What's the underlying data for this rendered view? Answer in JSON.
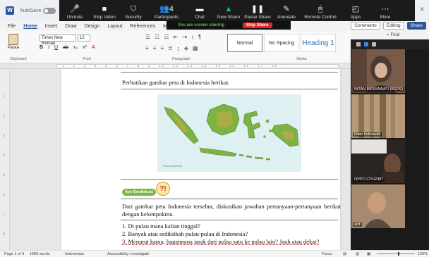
{
  "zoom": {
    "toolbar": [
      {
        "label": "Unmute",
        "icon": "microphone-muted-icon",
        "glyph": "🎤"
      },
      {
        "label": "Stop Video",
        "icon": "video-camera-icon",
        "glyph": "■"
      },
      {
        "label": "Security",
        "icon": "shield-icon",
        "glyph": "⛉"
      },
      {
        "label": "Participants",
        "icon": "participants-icon",
        "glyph": "👥",
        "count": "4"
      },
      {
        "label": "Chat",
        "icon": "chat-bubble-icon",
        "glyph": "▬"
      },
      {
        "label": "New Share",
        "icon": "share-arrow-icon",
        "glyph": "▲"
      },
      {
        "label": "Pause Share",
        "icon": "pause-icon",
        "glyph": "❚❚"
      },
      {
        "label": "Annotate",
        "icon": "pen-icon",
        "glyph": "✎"
      },
      {
        "label": "Remote Control",
        "icon": "mouse-icon",
        "glyph": "🖱"
      },
      {
        "label": "Apps",
        "icon": "apps-icon",
        "glyph": "◰"
      },
      {
        "label": "More",
        "icon": "more-dots-icon",
        "glyph": "⋯"
      }
    ],
    "share_status": "You are screen sharing",
    "stop_share_label": "Stop Share",
    "participants": [
      {
        "name": "INTAN INDRIAWATI (KEPS)"
      },
      {
        "name": "Intan Indriawati"
      },
      {
        "name": "OPPO CPH2387"
      },
      {
        "name": "acit"
      }
    ]
  },
  "word": {
    "autosave_label": "AutoSave",
    "menu": [
      "File",
      "Home",
      "Insert",
      "Draw",
      "Design",
      "Layout",
      "References",
      "Mailings"
    ],
    "active_menu": "Home",
    "comments_label": "Comments",
    "editing_label": "Editing",
    "share_label": "Share",
    "ribbon": {
      "paste_label": "Paste",
      "font_name": "Times New Roman",
      "font_size": "12",
      "group_labels": [
        "Clipboard",
        "Font",
        "Paragraph",
        "Styles"
      ],
      "styles": [
        "Normal",
        "No Spacing",
        "Heading 1"
      ],
      "find_label": "Find"
    },
    "document": {
      "intro": "Perhatikan gambar peta di Indonesia berikut.",
      "map_caption": "Peta Indonesia",
      "badge": "Ayo Berdiskusi",
      "question_mark": "?!",
      "discussion": "Dari gambar peta Indonesia tersebut, diskusikan jawaban pertanyaan-pertanyaan berikut dengan kelompokmu.",
      "questions": [
        "1. Di pulau mana kalian tinggal?",
        "2. Banyak atau sedikitkah pulau-pulau di Indonesia?",
        "3. Menurut kamu, bagaimana jarak dari pulau satu ke pulau lain? Jauh atau dekat?"
      ]
    },
    "status": {
      "page": "Page 1 of 9",
      "words": "1659 words",
      "language": "Indonesian",
      "accessibility": "Accessibility: Investigate",
      "focus": "Focus",
      "zoom": "120%"
    }
  }
}
